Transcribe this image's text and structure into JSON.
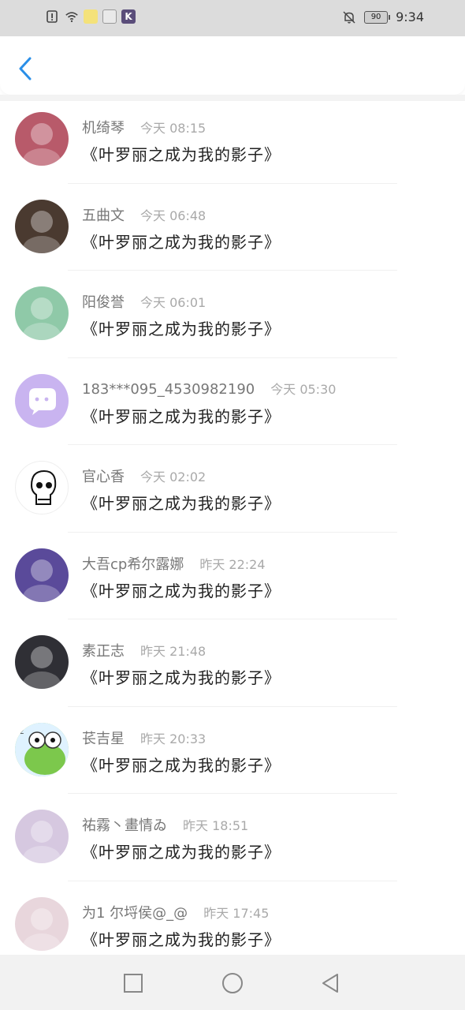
{
  "status_bar": {
    "icons_left": [
      "alert-icon",
      "wifi-icon",
      "app-icon-1",
      "app-icon-2",
      "app-icon-k"
    ],
    "app_k_label": "K",
    "bell_icon": "bell-off-icon",
    "battery": "90",
    "time": "9:34"
  },
  "header": {
    "back_icon": "chevron-left-icon",
    "accent": "#2a8fe8"
  },
  "messages": [
    {
      "name": "机绮琴",
      "time": "今天 08:15",
      "text": "《叶罗丽之成为我的影子》"
    },
    {
      "name": "五曲文",
      "time": "今天 06:48",
      "text": "《叶罗丽之成为我的影子》"
    },
    {
      "name": "阳俊誉",
      "time": "今天 06:01",
      "text": "《叶罗丽之成为我的影子》"
    },
    {
      "name": "183***095_4530982190",
      "time": "今天 05:30",
      "text": "《叶罗丽之成为我的影子》"
    },
    {
      "name": "官心香",
      "time": "今天 02:02",
      "text": "《叶罗丽之成为我的影子》"
    },
    {
      "name": "大吾cp希尔露娜",
      "time": "昨天 22:24",
      "text": "《叶罗丽之成为我的影子》"
    },
    {
      "name": "素正志",
      "time": "昨天 21:48",
      "text": "《叶罗丽之成为我的影子》"
    },
    {
      "name": "苌吉星",
      "time": "昨天 20:33",
      "text": "《叶罗丽之成为我的影子》"
    },
    {
      "name": "祐霧丶畫情ゐ",
      "time": "昨天 18:51",
      "text": "《叶罗丽之成为我的影子》"
    },
    {
      "name": "为1 尔埒侯@_@",
      "time": "昨天 17:45",
      "text": "《叶罗丽之成为我的影子》"
    }
  ],
  "avatars": [
    {
      "icon": "avatar-anime-girl-red",
      "bg": "#b85a6a"
    },
    {
      "icon": "avatar-photo-person",
      "bg": "#4a3a30"
    },
    {
      "icon": "avatar-anime-green",
      "bg": "#8fc9a8"
    },
    {
      "icon": "avatar-default-chat",
      "bg": "#c9b4f0"
    },
    {
      "icon": "avatar-skull-drawing",
      "bg": "#ffffff"
    },
    {
      "icon": "avatar-pony",
      "bg": "#5a4a9a"
    },
    {
      "icon": "avatar-group-photo",
      "bg": "#2f2f35"
    },
    {
      "icon": "avatar-frog",
      "bg": "#8ad06a"
    },
    {
      "icon": "avatar-anime-white-hair",
      "bg": "#d6c8e0"
    },
    {
      "icon": "avatar-anime-boy",
      "bg": "#e8d6dc"
    }
  ],
  "navbar": {
    "icons": [
      "square-icon",
      "circle-icon",
      "triangle-back-icon"
    ]
  }
}
